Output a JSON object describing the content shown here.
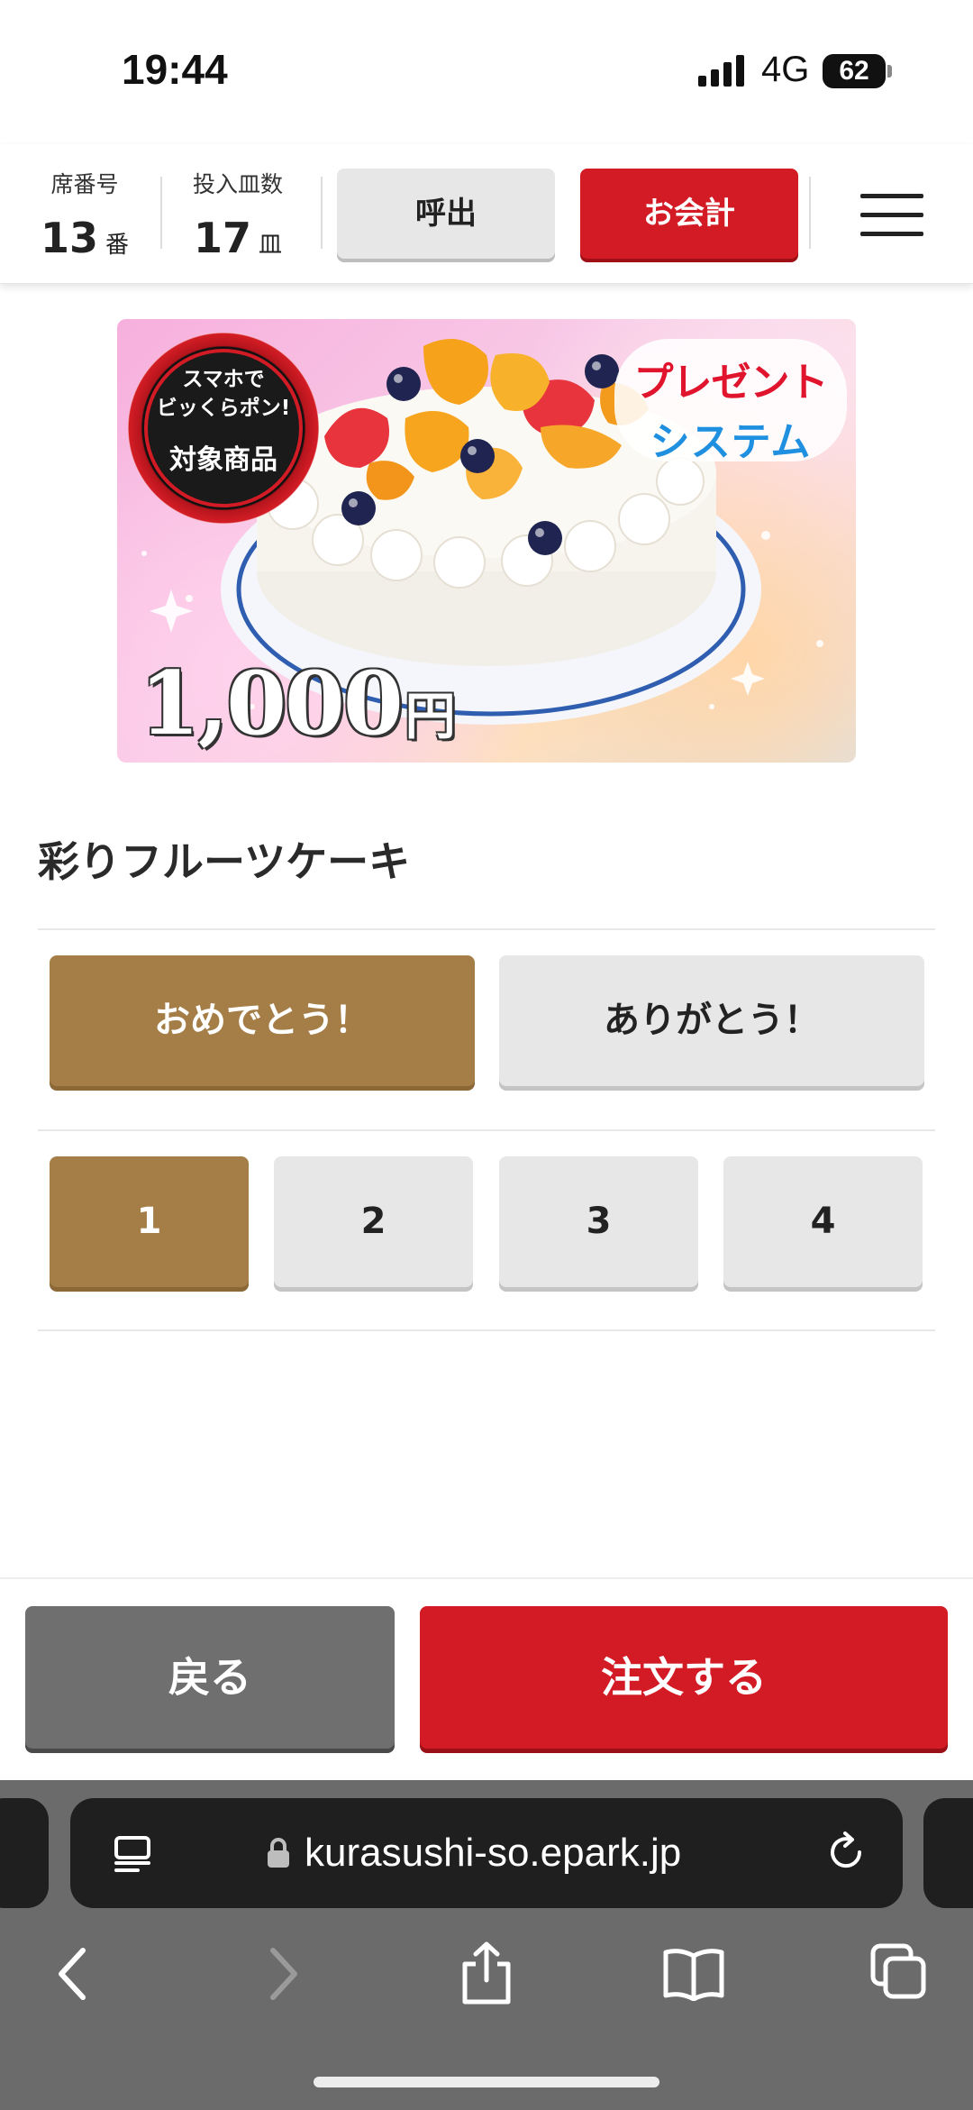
{
  "status_bar": {
    "time": "19:44",
    "network": "4G",
    "battery": "62"
  },
  "header": {
    "seat_label": "席番号",
    "seat_value": "13",
    "seat_unit": "番",
    "plates_label": "投入皿数",
    "plates_value": "17",
    "plates_unit": "皿",
    "call_button": "呼出",
    "bill_button": "お会計",
    "menu_icon": "hamburger-menu-icon"
  },
  "banner": {
    "badge_line1": "スマホで",
    "badge_line2": "ビッくらポン!",
    "badge_line3": "対象商品",
    "present_line1": "プレゼント",
    "present_line2": "システム",
    "price": "1,000",
    "currency": "円"
  },
  "product": {
    "name": "彩りフルーツケーキ"
  },
  "message_options": [
    {
      "label": "おめでとう！",
      "selected": true
    },
    {
      "label": "ありがとう！",
      "selected": false
    }
  ],
  "quantity_options": [
    {
      "label": "1",
      "selected": true
    },
    {
      "label": "2",
      "selected": false
    },
    {
      "label": "3",
      "selected": false
    },
    {
      "label": "4",
      "selected": false
    }
  ],
  "actions": {
    "back": "戻る",
    "order": "注文する"
  },
  "browser": {
    "url": "kurasushi-so.epark.jp"
  },
  "colors": {
    "accent_red": "#d21b24",
    "selected_gold": "#a47e46",
    "neutral_gray": "#e7e7e7"
  }
}
